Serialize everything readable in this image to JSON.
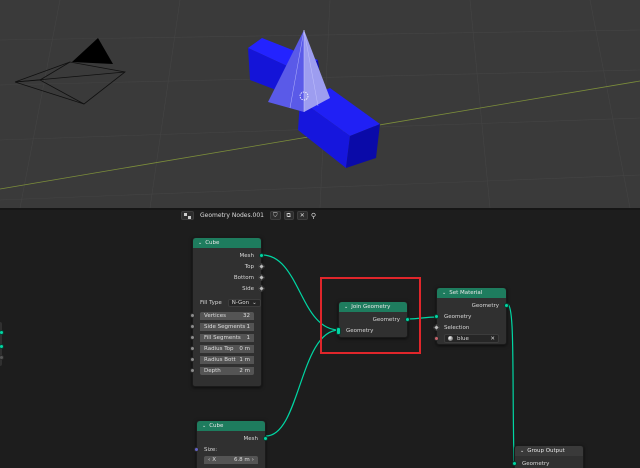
{
  "node_editor": {
    "header": {
      "editor_icon": "node-tree-icon",
      "tree_name": "Geometry Nodes.001",
      "shield_icon": "fake-user-shield-icon",
      "copy_icon": "duplicate-icon",
      "close_icon": "close-icon",
      "pin_icon": "pin-icon"
    },
    "nodes": {
      "cube_mesh": {
        "title": "Cube",
        "outputs": [
          "Mesh",
          "Top",
          "Bottom",
          "Side"
        ],
        "fill_type_label": "Fill Type",
        "fill_type_value": "N-Gon",
        "fields": [
          {
            "label": "Vertices",
            "value": "32"
          },
          {
            "label": "Side Segments",
            "value": "1"
          },
          {
            "label": "Fill Segments",
            "value": "1"
          },
          {
            "label": "Radius Top",
            "value": "0 m"
          },
          {
            "label": "Radius Bott",
            "value": "1 m"
          },
          {
            "label": "Depth",
            "value": "2 m"
          }
        ]
      },
      "join_geometry": {
        "title": "Join Geometry",
        "output": "Geometry",
        "input": "Geometry"
      },
      "set_material": {
        "title": "Set Material",
        "output": "Geometry",
        "input_geometry": "Geometry",
        "input_selection": "Selection",
        "material": "blue"
      },
      "cube_lower": {
        "title": "Cube",
        "output": "Mesh",
        "size_label": "Size:",
        "x_label": "X",
        "x_value": "6.8 m"
      },
      "group_output": {
        "title": "Group Output",
        "input": "Geometry"
      }
    }
  },
  "colors": {
    "geometry_socket": "#00d6a3",
    "node_header": "#1e7c5e",
    "highlight": "#e0262b",
    "viewport_bg": "#3a3a3a",
    "object_blue": "#1a1aee"
  }
}
